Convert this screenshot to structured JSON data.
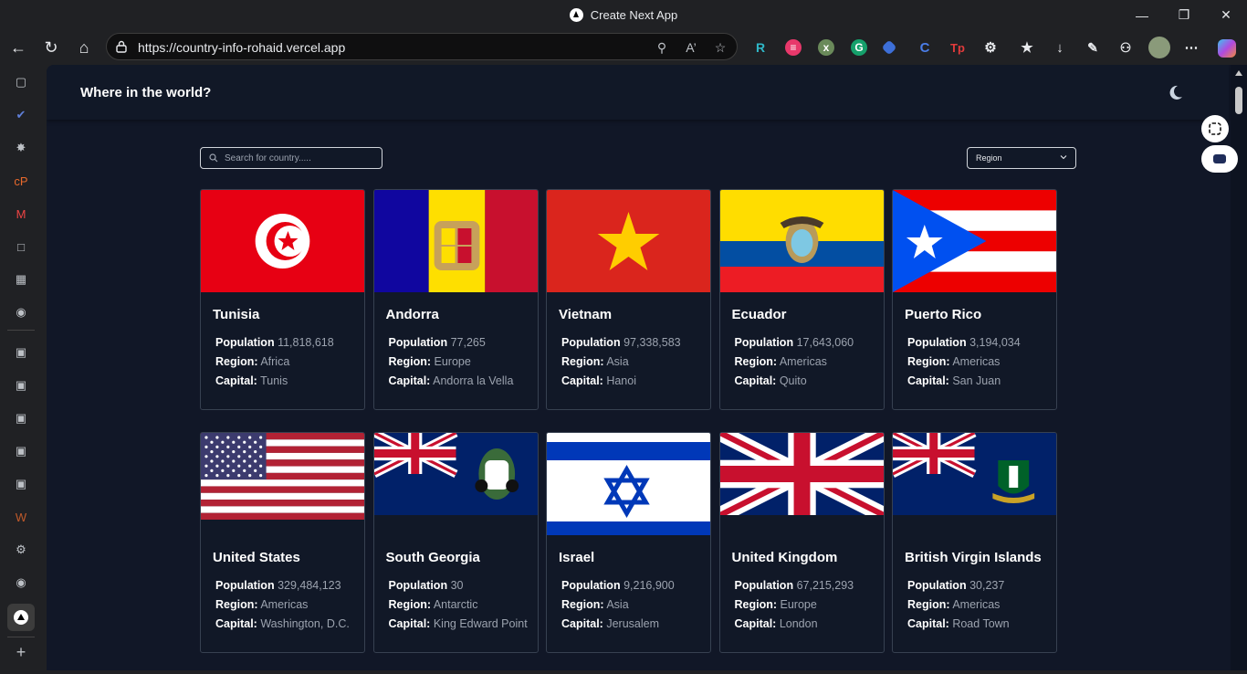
{
  "window": {
    "title": "Create Next App"
  },
  "toolbar": {
    "url": "https://country-info-rohaid.vercel.app"
  },
  "header": {
    "brand": "Where in the world?"
  },
  "filters": {
    "search_placeholder": "Search for country.....",
    "region_label": "Region"
  },
  "labels": {
    "population": "Population",
    "region": "Region:",
    "capital": "Capital:"
  },
  "countries": [
    {
      "name": "Tunisia",
      "population": "11,818,618",
      "region": "Africa",
      "capital": "Tunis",
      "flag": "tunisia"
    },
    {
      "name": "Andorra",
      "population": "77,265",
      "region": "Europe",
      "capital": "Andorra la Vella",
      "flag": "andorra"
    },
    {
      "name": "Vietnam",
      "population": "97,338,583",
      "region": "Asia",
      "capital": "Hanoi",
      "flag": "vietnam"
    },
    {
      "name": "Ecuador",
      "population": "17,643,060",
      "region": "Americas",
      "capital": "Quito",
      "flag": "ecuador"
    },
    {
      "name": "Puerto Rico",
      "population": "3,194,034",
      "region": "Americas",
      "capital": "San Juan",
      "flag": "puerto-rico"
    },
    {
      "name": "United States",
      "population": "329,484,123",
      "region": "Americas",
      "capital": "Washington, D.C.",
      "flag": "united-states"
    },
    {
      "name": "South Georgia",
      "population": "30",
      "region": "Antarctic",
      "capital": "King Edward Point",
      "flag": "south-georgia"
    },
    {
      "name": "Israel",
      "population": "9,216,900",
      "region": "Asia",
      "capital": "Jerusalem",
      "flag": "israel"
    },
    {
      "name": "United Kingdom",
      "population": "67,215,293",
      "region": "Europe",
      "capital": "London",
      "flag": "united-kingdom"
    },
    {
      "name": "British Virgin Islands",
      "population": "30,237",
      "region": "Americas",
      "capital": "Road Town",
      "flag": "british-virgin-islands"
    }
  ],
  "colors": {
    "page_bg": "#111727",
    "card_bg": "#111827",
    "card_border": "#374151",
    "value_text": "#9ca3af"
  }
}
